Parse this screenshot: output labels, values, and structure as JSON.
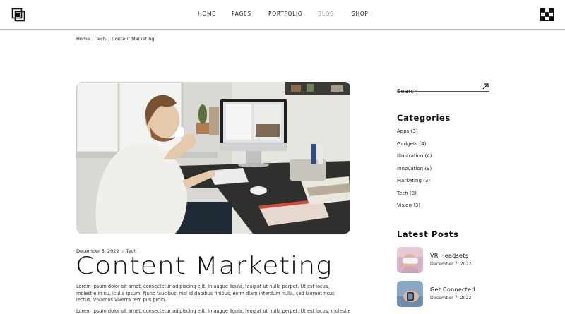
{
  "header": {
    "nav": [
      {
        "label": "Home",
        "active": false
      },
      {
        "label": "Pages",
        "active": false
      },
      {
        "label": "Portfolio",
        "active": false
      },
      {
        "label": "Blog",
        "active": true
      },
      {
        "label": "Shop",
        "active": false
      }
    ]
  },
  "breadcrumb": {
    "items": [
      "Home",
      "Tech",
      "Content Marketing"
    ],
    "separator": "/"
  },
  "post": {
    "date": "December 5, 2022",
    "category": "Tech",
    "title": "Content Marketing",
    "excerpt": "Lorem ipsum dolor sit amet, consectetur adipiscing elit. In augue ligula, feugiat ut nulla perpet. Ut est lacus, molestie in nu, iculia ipsum. Nunc faucibus, nisl id dapibus finibus, enim diam interdum nulla, sed laoreet risus lectus. Vivamus viverra tem pus proin.",
    "excerpt2": "Lorem ipsum dolor sit amet, consectetur adipiscing elit. In augue ligula, feugiat ut nulla perpet. Ut est lacus, molestie"
  },
  "sidebar": {
    "search_placeholder": "Search",
    "categories_heading": "Categories",
    "categories": [
      "Apps (3)",
      "Gadgets (4)",
      "Illustration (4)",
      "Innovation (9)",
      "Marketing (3)",
      "Tech (8)",
      "Vision (3)"
    ],
    "latest_heading": "Latest Posts",
    "latest": [
      {
        "title": "VR Headsets",
        "date": "December 7, 2022"
      },
      {
        "title": "Get Connected",
        "date": "December 7, 2022"
      }
    ]
  },
  "colors": {
    "accent": "#111111",
    "nav_active": "#9a9a9a",
    "divider": "#bdbdbd"
  }
}
